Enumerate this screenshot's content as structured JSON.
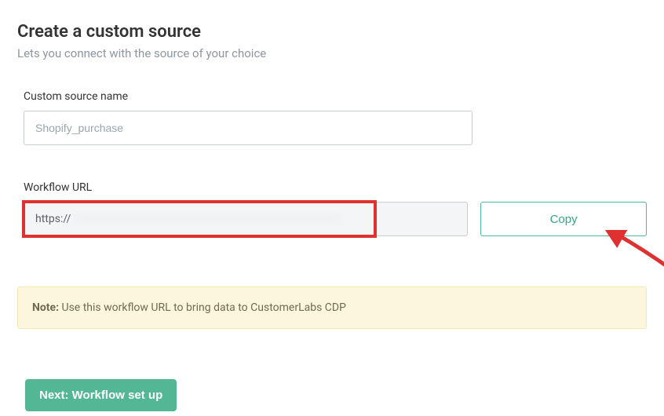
{
  "header": {
    "title": "Create a custom source",
    "subtitle": "Lets you connect with the source of your choice"
  },
  "form": {
    "source_name_label": "Custom source name",
    "source_name_value": "Shopify_purchase",
    "workflow_url_label": "Workflow URL",
    "workflow_url_value": "https://",
    "copy_button": "Copy"
  },
  "note": {
    "prefix": "Note:",
    "text": " Use this workflow URL to bring data to CustomerLabs CDP"
  },
  "footer": {
    "next_button": "Next: Workflow set up"
  },
  "colors": {
    "accent_green": "#53b796",
    "highlight_red": "#e03131",
    "note_bg": "#fdf6de"
  }
}
